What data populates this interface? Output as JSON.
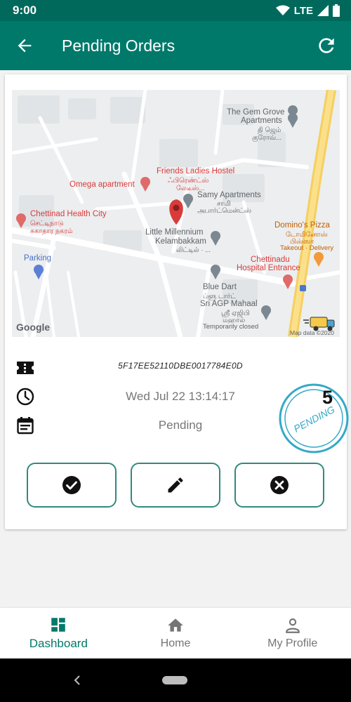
{
  "status_bar": {
    "time": "9:00",
    "network": "LTE"
  },
  "app_bar": {
    "title": "Pending Orders"
  },
  "map": {
    "labels": {
      "gem_grove": "The Gem Grove",
      "apartments": "Apartments",
      "gem_tamil": "தி ஜெம்",
      "gem_tamil2": "குரோவ்...",
      "friends": "Friends Ladies Hostel",
      "friends_tamil": "ஃபிரெண்ட்ஸ்",
      "friends_tamil2": "லேடீஸ்...",
      "omega": "Omega apartment",
      "samy": "Samy Apartments",
      "samy_tamil": "சாமி",
      "samy_tamil2": "அபார்ட்மென்ட்ஸ்",
      "chettinad_health": "Chettinad Health City",
      "chettinad_tamil": "செட்டிநாடு",
      "chettinad_tamil2": "சுகாதார நகரம்",
      "little_mill": "Little Millennium",
      "kelambakkam": "Kelambakkam",
      "little_tamil": "லிட்டில் · ...",
      "dominos": "Domino's Pizza",
      "dominos_tamil": "டோமினோஸ்",
      "dominos_tamil2": "பிஸ்ஸா",
      "takeout": "Takeout · Delivery",
      "parking": "Parking",
      "hospital1": "Chettinadu",
      "hospital2": "Hospital Entrance",
      "blue_dart": "Blue Dart",
      "blue_dart_tamil": "ப்ளூ டார்ட்",
      "sri_agp": "Sri AGP Mahaal",
      "sri_tamil": "ஸ்ரீ ஏஜிபி",
      "sri_tamil2": "மஹால்",
      "temp_closed": "Temporarily closed",
      "google": "Google",
      "map_data": "Map data ©2020"
    }
  },
  "order": {
    "id": "5F17EE52110DBE0017784E0D",
    "date": "Wed Jul 22 13:14:17",
    "status": "Pending",
    "stamp_text": "PENDING",
    "count": "5"
  },
  "bottom_nav": {
    "items": [
      {
        "label": "Dashboard",
        "active": true
      },
      {
        "label": "Home",
        "active": false
      },
      {
        "label": "My Profile",
        "active": false
      }
    ]
  },
  "colors": {
    "primary": "#00796b",
    "primary_dark": "#00695c",
    "accent_border": "#2e8b7e",
    "stamp": "#35a9c7",
    "map_pin": "#d93b3b"
  }
}
